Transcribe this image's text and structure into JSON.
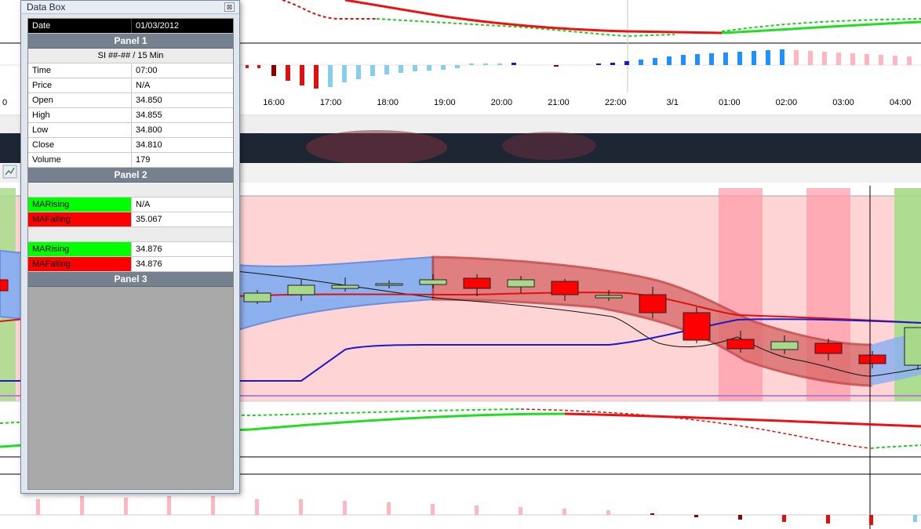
{
  "data_box": {
    "title": "Data Box",
    "close_glyph": "⊠",
    "date_label": "Date",
    "date_value": "01/03/2012",
    "panel1": {
      "title": "Panel 1",
      "instrument": "SI ##-## / 15 Min",
      "rows": [
        {
          "label": "Time",
          "value": "07:00"
        },
        {
          "label": "Price",
          "value": "N/A"
        },
        {
          "label": "Open",
          "value": "34.850"
        },
        {
          "label": "High",
          "value": "34.855"
        },
        {
          "label": "Low",
          "value": "34.800"
        },
        {
          "label": "Close",
          "value": "34.810"
        },
        {
          "label": "Volume",
          "value": "179"
        }
      ]
    },
    "panel2": {
      "title": "Panel 2",
      "group1": [
        {
          "label": "MARising",
          "value": "N/A"
        },
        {
          "label": "MAFalling",
          "value": "35.067"
        }
      ],
      "group2": [
        {
          "label": "MARising",
          "value": "34.876"
        },
        {
          "label": "MAFalling",
          "value": "34.876"
        }
      ]
    },
    "panel3": {
      "title": "Panel 3"
    }
  },
  "time_axis": {
    "labels": [
      {
        "text": "0",
        "slot": 0
      },
      {
        "text": "16:00",
        "slot": 5
      },
      {
        "text": "17:00",
        "slot": 6
      },
      {
        "text": "18:00",
        "slot": 7
      },
      {
        "text": "19:00",
        "slot": 8
      },
      {
        "text": "20:00",
        "slot": 9
      },
      {
        "text": "21:00",
        "slot": 10
      },
      {
        "text": "22:00",
        "slot": 11
      },
      {
        "text": "3/1",
        "slot": 12
      },
      {
        "text": "01:00",
        "slot": 13
      },
      {
        "text": "02:00",
        "slot": 14
      },
      {
        "text": "03:00",
        "slot": 15
      },
      {
        "text": "04:00",
        "slot": 16
      }
    ]
  },
  "colors": {
    "rising": "#00ff00",
    "falling": "#ff0000",
    "bull_candle": "#a8d88a",
    "bear_candle": "#ff0000",
    "ma_line": "#e01010",
    "blue_line": "#1a1acc",
    "band_blue": "#8db0ee",
    "band_red": "#d96a6a",
    "bg_pink": "#ffd4d4",
    "bg_green": "#a8dd8c"
  },
  "icons": {
    "chart_thumb": "chart-icon"
  }
}
